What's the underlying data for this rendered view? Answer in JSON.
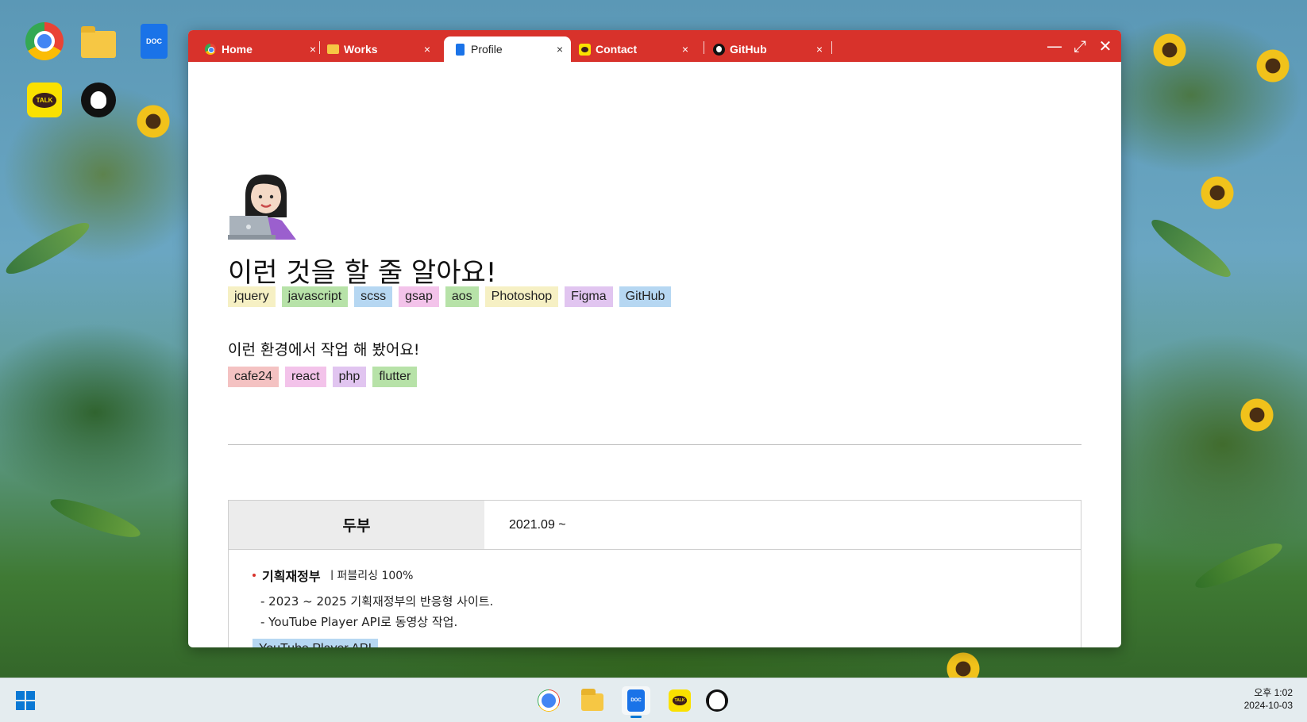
{
  "desktop": {
    "icons": [
      {
        "name": "chrome",
        "icon": "chrome-icon"
      },
      {
        "name": "files",
        "icon": "folder-icon"
      },
      {
        "name": "doc",
        "icon": "doc-icon",
        "label": "DOC"
      },
      {
        "name": "kakaotalk",
        "icon": "kakaotalk-icon",
        "label": "TALK"
      },
      {
        "name": "github",
        "icon": "github-icon"
      }
    ]
  },
  "window": {
    "tabs": [
      {
        "label": "Home",
        "icon": "chrome-icon",
        "active": false
      },
      {
        "label": "Works",
        "icon": "folder-icon",
        "active": false
      },
      {
        "label": "Profile",
        "icon": "doc-icon",
        "active": true
      },
      {
        "label": "Contact",
        "icon": "kakaotalk-icon",
        "active": false
      },
      {
        "label": "GitHub",
        "icon": "github-icon",
        "active": false
      }
    ],
    "close_glyph": "×",
    "controls": {
      "minimize": "—",
      "maximize": "⤢",
      "close": "✕"
    }
  },
  "profile": {
    "avatar": "woman-technologist-emoji",
    "title": "이런 것을 할 줄 알아요!",
    "skills": [
      {
        "label": "jquery",
        "color": "#f6f0c4"
      },
      {
        "label": "javascript",
        "color": "#b7e2a8"
      },
      {
        "label": "scss",
        "color": "#b6d7f2"
      },
      {
        "label": "gsap",
        "color": "#f3c3ea"
      },
      {
        "label": "aos",
        "color": "#b7e2a8"
      },
      {
        "label": "Photoshop",
        "color": "#f6f0c4"
      },
      {
        "label": "Figma",
        "color": "#e1c5f0"
      },
      {
        "label": "GitHub",
        "color": "#b6d7f2"
      }
    ],
    "env_heading": "이런 환경에서 작업 해 봤어요!",
    "environments": [
      {
        "label": "cafe24",
        "color": "#f4c2c2"
      },
      {
        "label": "react",
        "color": "#f3c3ea"
      },
      {
        "label": "php",
        "color": "#e1c5f0"
      },
      {
        "label": "flutter",
        "color": "#b7e2a8"
      }
    ]
  },
  "experience": {
    "company": "두부",
    "period": "2021.09 ~",
    "project": {
      "title": "기획재정부",
      "meta": "ㅣ퍼블리싱 100%",
      "lines": [
        "- 2023 ~ 2025 기획재정부의 반응형 사이트.",
        "- YouTube Player API로 동영상 작업."
      ],
      "tag": {
        "label": "YouTube Player API",
        "color": "#b6d7f2"
      }
    }
  },
  "taskbar": {
    "time": "오후 1:02",
    "date": "2024-10-03",
    "doc_label": "DOC",
    "talk_label": "TALK"
  }
}
